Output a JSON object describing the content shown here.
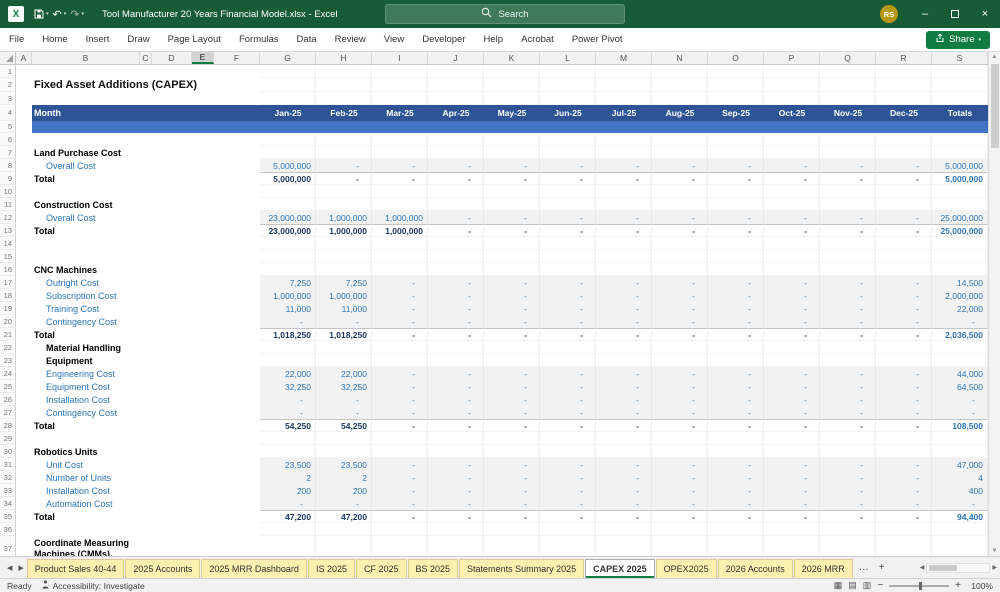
{
  "titlebar": {
    "title": "Tool Manufacturer 20 Years Financial Model.xlsx - Excel",
    "search_placeholder": "Search",
    "avatar_initials": "RS"
  },
  "ribbon": {
    "tabs": [
      "File",
      "Home",
      "Insert",
      "Draw",
      "Page Layout",
      "Formulas",
      "Data",
      "Review",
      "View",
      "Developer",
      "Help",
      "Acrobat",
      "Power Pivot"
    ],
    "share_label": "Share"
  },
  "grid": {
    "column_letters": [
      "A",
      "B",
      "C",
      "D",
      "E",
      "F",
      "G",
      "H",
      "I",
      "J",
      "K",
      "L",
      "M",
      "N",
      "O",
      "P",
      "Q",
      "R",
      "S"
    ],
    "selected_column": "E",
    "header": {
      "month_label": "Month",
      "months": [
        "Jan-25",
        "Feb-25",
        "Mar-25",
        "Apr-25",
        "May-25",
        "Jun-25",
        "Jul-25",
        "Aug-25",
        "Sep-25",
        "Oct-25",
        "Nov-25",
        "Dec-25"
      ],
      "totals_label": "Totals"
    },
    "rows": [
      {
        "n": 1,
        "type": "blank"
      },
      {
        "n": 2,
        "type": "title",
        "label": "Fixed Asset Additions (CAPEX)"
      },
      {
        "n": 3,
        "type": "blank"
      },
      {
        "n": 4,
        "type": "header"
      },
      {
        "n": 5,
        "type": "band"
      },
      {
        "n": 6,
        "type": "blank"
      },
      {
        "n": 7,
        "type": "section",
        "label": "Land Purchase Cost"
      },
      {
        "n": 8,
        "type": "item",
        "label": "Overall Cost",
        "values": [
          "5,000,000",
          "-",
          "-",
          "-",
          "-",
          "-",
          "-",
          "-",
          "-",
          "-",
          "-",
          "-"
        ],
        "total": "5,000,000"
      },
      {
        "n": 9,
        "type": "total",
        "label": "Total",
        "values": [
          "5,000,000",
          "-",
          "-",
          "-",
          "-",
          "-",
          "-",
          "-",
          "-",
          "-",
          "-",
          "-"
        ],
        "total": "5,000,000"
      },
      {
        "n": 10,
        "type": "blank"
      },
      {
        "n": 11,
        "type": "section",
        "label": "Construction Cost"
      },
      {
        "n": 12,
        "type": "item",
        "label": "Overall Cost",
        "values": [
          "23,000,000",
          "1,000,000",
          "1,000,000",
          "-",
          "-",
          "-",
          "-",
          "-",
          "-",
          "-",
          "-",
          "-"
        ],
        "total": "25,000,000"
      },
      {
        "n": 13,
        "type": "total",
        "label": "Total",
        "values": [
          "23,000,000",
          "1,000,000",
          "1,000,000",
          "-",
          "-",
          "-",
          "-",
          "-",
          "-",
          "-",
          "-",
          "-"
        ],
        "total": "25,000,000"
      },
      {
        "n": 14,
        "type": "blank"
      },
      {
        "n": 15,
        "type": "blank"
      },
      {
        "n": 16,
        "type": "section",
        "label": "CNC Machines"
      },
      {
        "n": 17,
        "type": "item",
        "label": "Outright Cost",
        "values": [
          "7,250",
          "7,250",
          "-",
          "-",
          "-",
          "-",
          "-",
          "-",
          "-",
          "-",
          "-",
          "-"
        ],
        "total": "14,500"
      },
      {
        "n": 18,
        "type": "item",
        "label": "Subscription Cost",
        "values": [
          "1,000,000",
          "1,000,000",
          "-",
          "-",
          "-",
          "-",
          "-",
          "-",
          "-",
          "-",
          "-",
          "-"
        ],
        "total": "2,000,000"
      },
      {
        "n": 19,
        "type": "item",
        "label": "Training Cost",
        "values": [
          "11,000",
          "11,000",
          "-",
          "-",
          "-",
          "-",
          "-",
          "-",
          "-",
          "-",
          "-",
          "-"
        ],
        "total": "22,000"
      },
      {
        "n": 20,
        "type": "item",
        "label": "Contingency Cost",
        "values": [
          "-",
          "-",
          "-",
          "-",
          "-",
          "-",
          "-",
          "-",
          "-",
          "-",
          "-",
          "-"
        ],
        "total": "-"
      },
      {
        "n": 21,
        "type": "total",
        "label": "Total",
        "values": [
          "1,018,250",
          "1,018,250",
          "-",
          "-",
          "-",
          "-",
          "-",
          "-",
          "-",
          "-",
          "-",
          "-"
        ],
        "total": "2,036,500"
      },
      {
        "n": 22,
        "type": "section-indent",
        "label": "Material Handling"
      },
      {
        "n": 23,
        "type": "section-indent",
        "label": "Equipment"
      },
      {
        "n": 24,
        "type": "item",
        "label": "Engineering Cost",
        "values": [
          "22,000",
          "22,000",
          "-",
          "-",
          "-",
          "-",
          "-",
          "-",
          "-",
          "-",
          "-",
          "-"
        ],
        "total": "44,000"
      },
      {
        "n": 25,
        "type": "item",
        "label": "Equipment Cost",
        "values": [
          "32,250",
          "32,250",
          "-",
          "-",
          "-",
          "-",
          "-",
          "-",
          "-",
          "-",
          "-",
          "-"
        ],
        "total": "64,500"
      },
      {
        "n": 26,
        "type": "item",
        "label": "Installation Cost",
        "values": [
          "-",
          "-",
          "-",
          "-",
          "-",
          "-",
          "-",
          "-",
          "-",
          "-",
          "-",
          "-"
        ],
        "total": "-"
      },
      {
        "n": 27,
        "type": "item",
        "label": "Contingency Cost",
        "values": [
          "-",
          "-",
          "-",
          "-",
          "-",
          "-",
          "-",
          "-",
          "-",
          "-",
          "-",
          "-"
        ],
        "total": "-"
      },
      {
        "n": 28,
        "type": "total",
        "label": "Total",
        "values": [
          "54,250",
          "54,250",
          "-",
          "-",
          "-",
          "-",
          "-",
          "-",
          "-",
          "-",
          "-",
          "-"
        ],
        "total": "108,500"
      },
      {
        "n": 29,
        "type": "blank"
      },
      {
        "n": 30,
        "type": "section",
        "label": "Robotics Units"
      },
      {
        "n": 31,
        "type": "item",
        "label": "Unit Cost",
        "values": [
          "23,500",
          "23,500",
          "-",
          "-",
          "-",
          "-",
          "-",
          "-",
          "-",
          "-",
          "-",
          "-"
        ],
        "total": "47,000"
      },
      {
        "n": 32,
        "type": "item",
        "label": "Number of Units",
        "values": [
          "2",
          "2",
          "-",
          "-",
          "-",
          "-",
          "-",
          "-",
          "-",
          "-",
          "-",
          "-"
        ],
        "total": "4"
      },
      {
        "n": 33,
        "type": "item",
        "label": "Installation Cost",
        "values": [
          "200",
          "200",
          "-",
          "-",
          "-",
          "-",
          "-",
          "-",
          "-",
          "-",
          "-",
          "-"
        ],
        "total": "400"
      },
      {
        "n": 34,
        "type": "item",
        "label": "Automation Cost",
        "values": [
          "-",
          "-",
          "-",
          "-",
          "-",
          "-",
          "-",
          "-",
          "-",
          "-",
          "-",
          "-"
        ],
        "total": "-"
      },
      {
        "n": 35,
        "type": "total",
        "label": "Total",
        "values": [
          "47,200",
          "47,200",
          "-",
          "-",
          "-",
          "-",
          "-",
          "-",
          "-",
          "-",
          "-",
          "-"
        ],
        "total": "94,400"
      },
      {
        "n": 36,
        "type": "blank"
      },
      {
        "n": 37,
        "type": "section-tall",
        "label": "Coordinate Measuring",
        "label2": "Machines (CMMs),"
      }
    ]
  },
  "sheet_tabs": {
    "labels": [
      "Product Sales 40-44",
      "2025 Accounts",
      "2025 MRR Dashboard",
      "IS 2025",
      "CF 2025",
      "BS 2025",
      "Statements Summary 2025",
      "CAPEX 2025",
      "OPEX2025",
      "2026 Accounts",
      "2026 MRR"
    ],
    "active": "CAPEX 2025",
    "overflow": "…",
    "add": "+"
  },
  "statusbar": {
    "mode": "Ready",
    "accessibility": "Accessibility: Investigate",
    "zoom": "100%"
  }
}
